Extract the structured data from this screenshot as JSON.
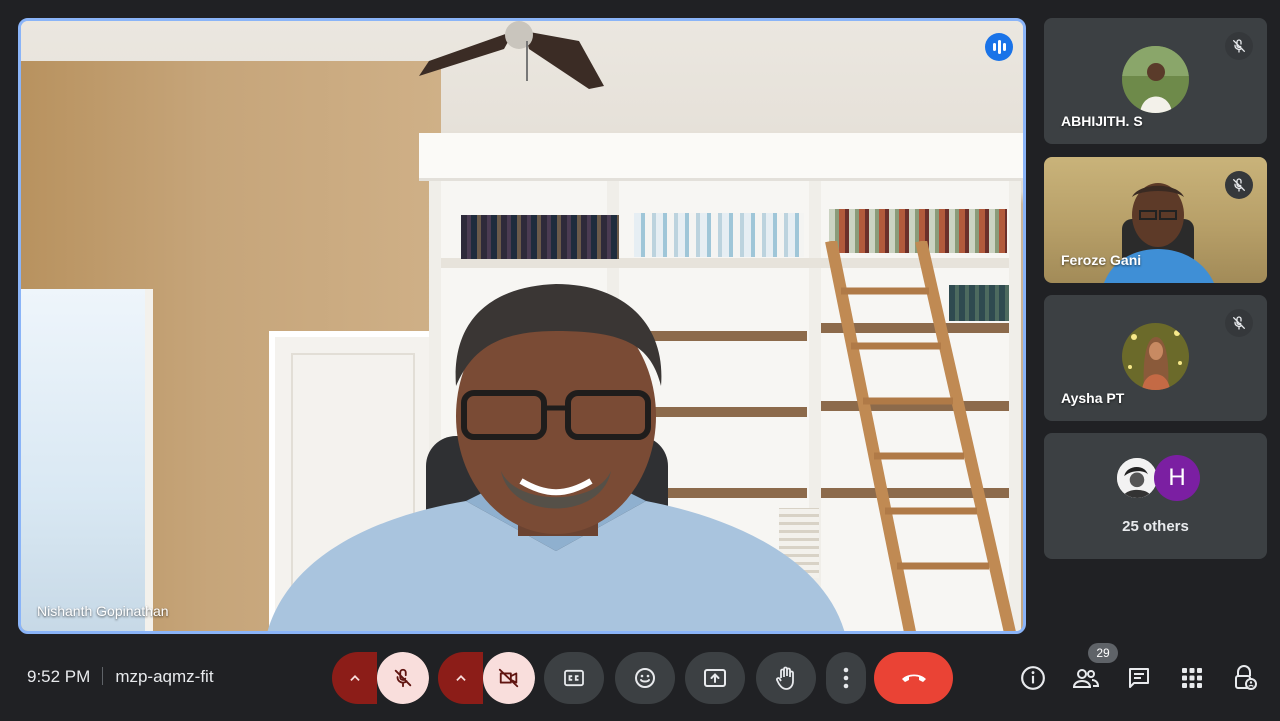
{
  "main_speaker": {
    "name": "Nishanth Gopinathan",
    "speaking_icon": "audio-levels-icon"
  },
  "participants": [
    {
      "name": "ABHIJITH. S",
      "muted": true,
      "mute_icon": "mic-off-icon"
    },
    {
      "name": "Feroze Gani",
      "muted": true,
      "mute_icon": "mic-off-icon"
    },
    {
      "name": "Aysha PT",
      "muted": true,
      "mute_icon": "mic-off-icon"
    }
  ],
  "others": {
    "initial": "H",
    "label": "25 others"
  },
  "meeting": {
    "time": "9:52 PM",
    "code": "mzp-aqmz-fit"
  },
  "controls": {
    "mic": {
      "state": "off",
      "icon": "mic-off-icon",
      "options_icon": "chevron-up-icon"
    },
    "camera": {
      "state": "off",
      "icon": "videocam-off-icon",
      "options_icon": "chevron-up-icon"
    },
    "captions_icon": "closed-captions-icon",
    "emoji_icon": "emoji-icon",
    "present_icon": "present-screen-icon",
    "raise_hand_icon": "hand-icon",
    "more_icon": "more-vert-icon",
    "hangup_icon": "call-end-icon"
  },
  "right_panel": {
    "info_icon": "info-icon",
    "people_icon": "people-icon",
    "people_count": "29",
    "chat_icon": "chat-icon",
    "activities_icon": "apps-grid-icon",
    "host_controls_icon": "lock-person-icon"
  },
  "colors": {
    "background": "#202124",
    "tile": "#3c4043",
    "active_border": "#8ab4f8",
    "muted_red": "#8c1d18",
    "muted_pink": "#f9dedc",
    "hangup_red": "#ea4335"
  }
}
